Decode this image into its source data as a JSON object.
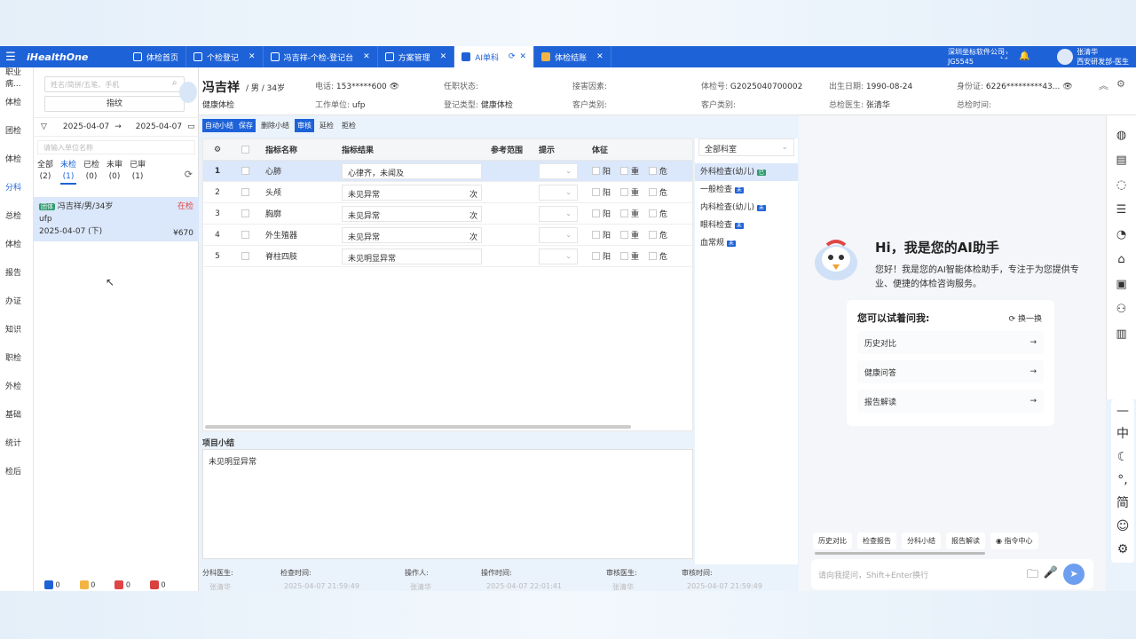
{
  "topbar": {
    "logo": "iHealthOne",
    "tabs": [
      {
        "label": "体检首页",
        "closable": false,
        "active": false
      },
      {
        "label": "个检登记",
        "closable": true,
        "active": false
      },
      {
        "label": "冯吉祥-个检-登记台",
        "closable": true,
        "active": false
      },
      {
        "label": "方案管理",
        "closable": true,
        "active": false
      },
      {
        "label": "AI单科",
        "closable": true,
        "active": true
      },
      {
        "label": "体检结账",
        "closable": true,
        "active": false
      }
    ],
    "company_line1": "深圳坐标软件公司",
    "company_line2": "JG5545",
    "user_name": "张清华",
    "user_dept": "西安研发部-医生"
  },
  "leftnav": [
    "职业病...",
    "体检",
    "团检",
    "体检",
    "分科",
    "总检",
    "体检",
    "报告",
    "办证",
    "知识",
    "职检",
    "外检",
    "基础",
    "统计",
    "检后"
  ],
  "patient_panel": {
    "search_placeholder": "姓名/简拼/五笔、手机",
    "search_button": "指纹",
    "date_from": "2025-04-07",
    "date_to": "2025-04-07",
    "unit_placeholder": "请输入单位名称",
    "filters": [
      {
        "label": "全部",
        "count": "(2)"
      },
      {
        "label": "未检",
        "count": "(1)"
      },
      {
        "label": "已检",
        "count": "(0)"
      },
      {
        "label": "未审",
        "count": "(0)"
      },
      {
        "label": "已审",
        "count": "(1)"
      }
    ],
    "card": {
      "tag": "团体",
      "name": "冯吉祥/男/34岁",
      "status": "在检",
      "unit": "ufp",
      "date": "2025-04-07 (下)",
      "price": "¥670"
    },
    "bottom_counts": [
      "0",
      "0",
      "0",
      "0"
    ]
  },
  "header": {
    "name": "冯吉祥",
    "gender_age": "/ 男 / 34岁",
    "type": "健康体检",
    "phone_label": "电话:",
    "phone": "153*****600",
    "work_label": "工作单位:",
    "work": "ufp",
    "job_label": "任职状态:",
    "reg_label": "登记类型:",
    "reg": "健康体检",
    "hazard_label": "接害因素:",
    "cust_label": "客户类别:",
    "cust2_label": "客户类别:",
    "exam_no_label": "体检号:",
    "exam_no": "G2025040700002",
    "birth_label": "出生日期:",
    "birth": "1990-08-24",
    "doctor_label": "总检医生:",
    "doctor": "张清华",
    "id_label": "身份证:",
    "id": "6226*********43...",
    "time_label": "总检时间:"
  },
  "toolbar": {
    "auto_summary": "自动小结",
    "save": "保存",
    "delete_summary": "删除小结",
    "review": "审核",
    "postpone": "延检",
    "refuse": "拒检"
  },
  "grid": {
    "headers": {
      "name": "指标名称",
      "result": "指标结果",
      "range": "参考范围",
      "hint": "提示",
      "sign": "体征"
    },
    "rows": [
      {
        "no": "1",
        "name": "心肺",
        "result": "心律齐，未闻及",
        "count": ""
      },
      {
        "no": "2",
        "name": "头颅",
        "result": "未见异常",
        "count": "次"
      },
      {
        "no": "3",
        "name": "胸廓",
        "result": "未见异常",
        "count": "次"
      },
      {
        "no": "4",
        "name": "外生殖器",
        "result": "未见异常",
        "count": "次"
      },
      {
        "no": "5",
        "name": "脊柱四肢",
        "result": "未见明显异常",
        "count": ""
      }
    ],
    "sign_labels": {
      "yang": "阳",
      "zhong": "重",
      "wei": "危"
    }
  },
  "summary": {
    "title": "项目小结",
    "text": "未见明显异常"
  },
  "footer": {
    "dept_doctor_label": "分科医生:",
    "dept_doctor": "张清华",
    "check_time_label": "检查时间:",
    "check_time": "2025-04-07 21:59:49",
    "operator_label": "操作人:",
    "operator": "张清华",
    "op_time_label": "操作时间:",
    "op_time": "2025-04-07 22:01:41",
    "review_doctor_label": "审核医生:",
    "review_doctor": "张清华",
    "review_time_label": "审核时间:",
    "review_time": "2025-04-07 21:59:49"
  },
  "departments": {
    "select": "全部科室",
    "items": [
      {
        "name": "外科检查(幼儿)",
        "badge": "已",
        "active": true
      },
      {
        "name": "一般检查",
        "badge": "未",
        "active": false
      },
      {
        "name": "内科检查(幼儿)",
        "badge": "未",
        "active": false
      },
      {
        "name": "眼科检查",
        "badge": "未",
        "active": false
      },
      {
        "name": "血常规",
        "badge": "未",
        "active": false
      }
    ]
  },
  "ai": {
    "greeting": "Hi，我是您的AI助手",
    "intro": "您好！我是您的AI智能体检助手，专注于为您提供专业、便捷的体检咨询服务。",
    "suggest_title": "您可以试着问我:",
    "refresh": "换一换",
    "suggestions": [
      "历史对比",
      "健康问答",
      "报告解读"
    ],
    "quick": [
      "历史对比",
      "检查报告",
      "分科小结",
      "报告解读",
      "指令中心"
    ],
    "input_placeholder": "请向我提问，Shift+Enter换行"
  },
  "right_tools": {
    "lang": "中",
    "simp": "简"
  },
  "colors": {
    "primary": "#1e62d8",
    "selected": "#dbe7fa",
    "danger": "#e04545"
  }
}
